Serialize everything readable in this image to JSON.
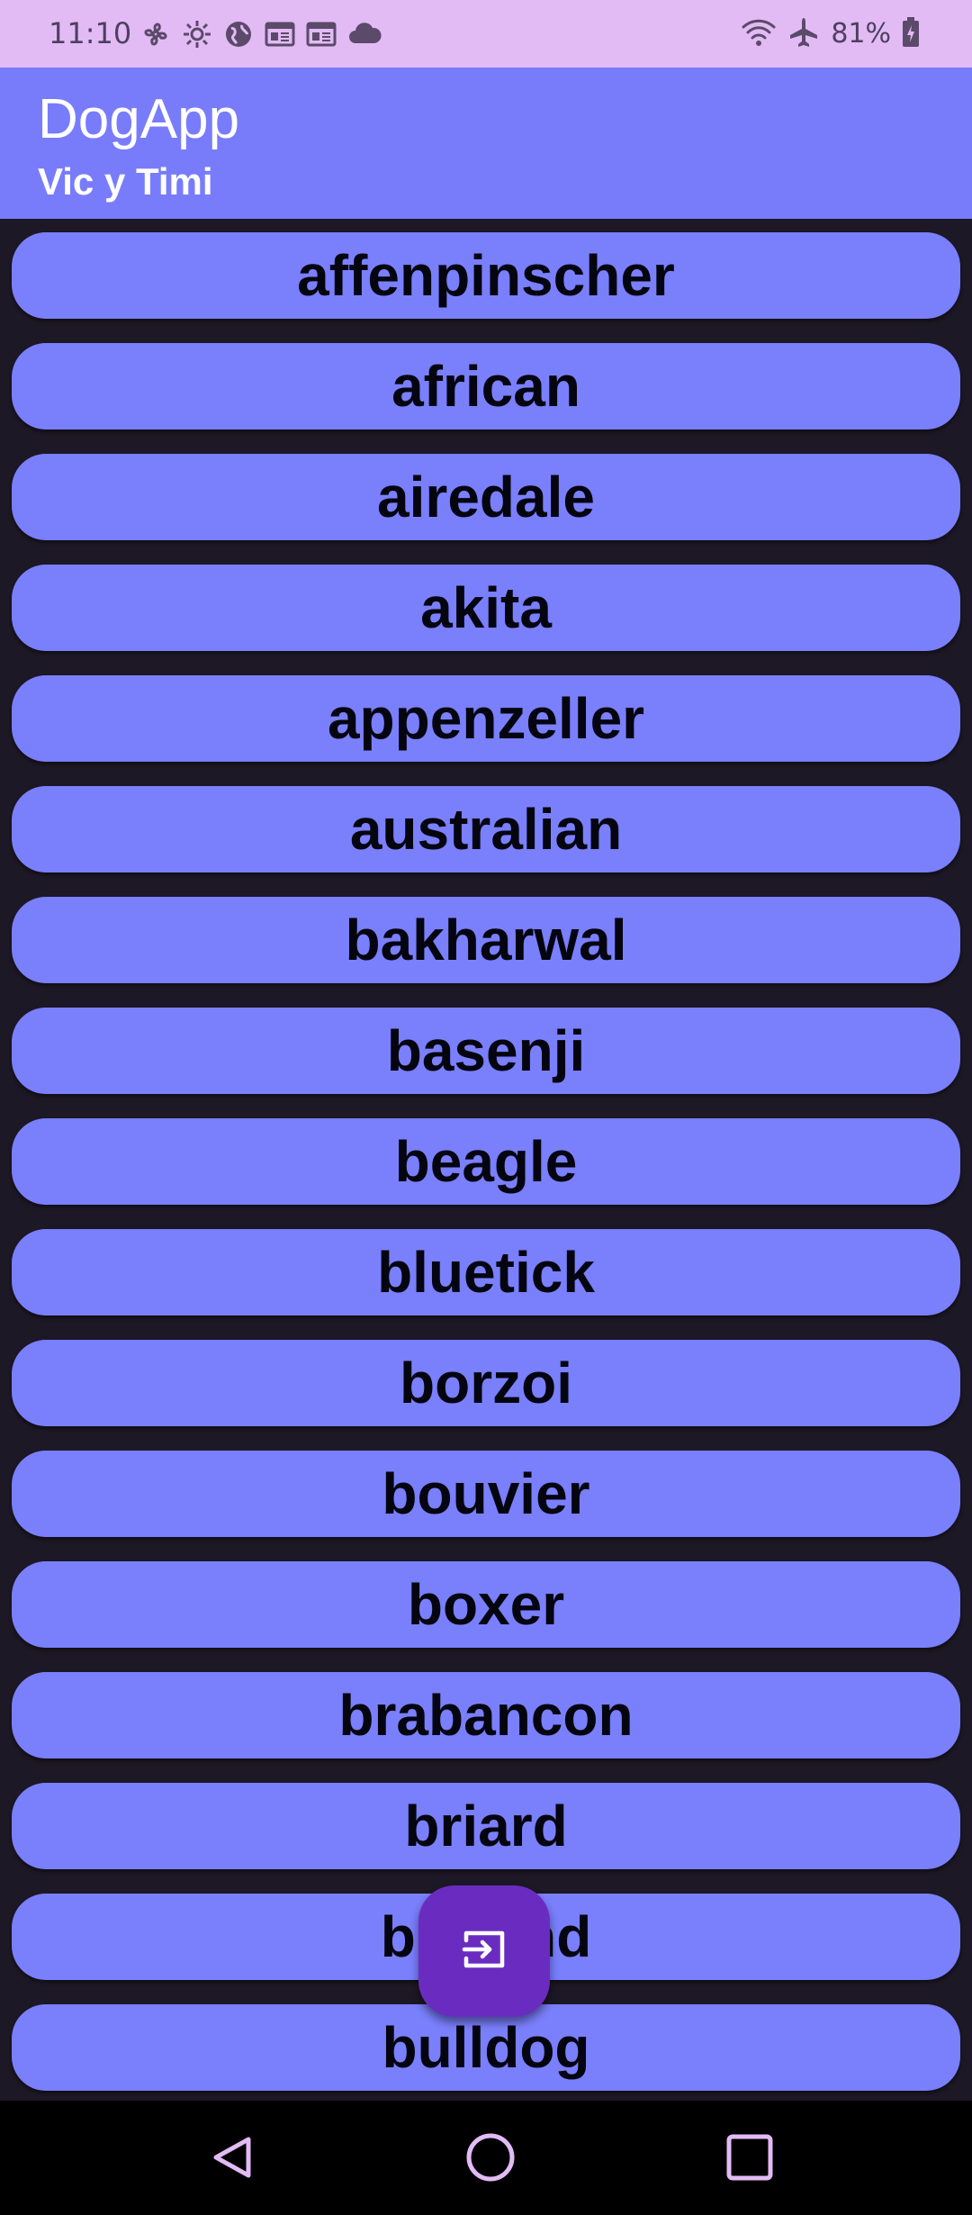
{
  "status_bar": {
    "time": "11:10",
    "battery": "81%",
    "left_icons": [
      "fan-icon",
      "settings-icon",
      "globe-icon",
      "news-icon",
      "news-icon",
      "cloud-icon"
    ],
    "right_icons": [
      "wifi-icon",
      "airplane-icon",
      "battery-icon"
    ]
  },
  "app_bar": {
    "title": "DogApp",
    "subtitle": "Vic y Timi",
    "background": "#787cfb"
  },
  "breeds": {
    "items": [
      "affenpinscher",
      "african",
      "airedale",
      "akita",
      "appenzeller",
      "australian",
      "bakharwal",
      "basenji",
      "beagle",
      "bluetick",
      "borzoi",
      "bouvier",
      "boxer",
      "brabancon",
      "briard",
      "buhund",
      "bulldog"
    ],
    "button_color": "#7a7ffc"
  },
  "fab": {
    "icon": "exit-icon",
    "color": "#6a2cc0"
  },
  "nav_bar": {
    "icons": [
      "back-icon",
      "home-icon",
      "recents-icon"
    ]
  }
}
